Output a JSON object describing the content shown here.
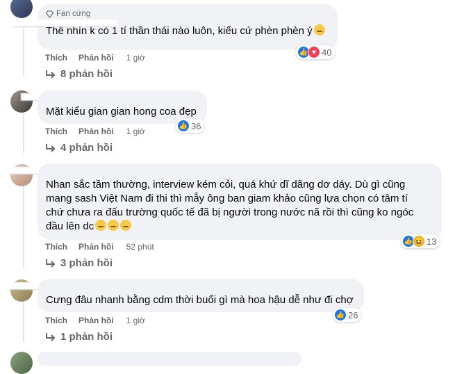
{
  "comments": [
    {
      "badge": "Fan cứng",
      "text": "Thề nhìn k có 1 tí thần thái nào luôn, kiểu cứ phèn phèn ý",
      "like": "Thích",
      "reply": "Phản hồi",
      "time": "1 giờ",
      "reaction_count": "40",
      "replies": "8 phản hồi"
    },
    {
      "text": "Mặt kiểu gian gian hong coa đẹp",
      "like": "Thích",
      "reply": "Phản hồi",
      "time": "1 giờ",
      "reaction_count": "36",
      "replies": "4 phản hồi"
    },
    {
      "text_lines": [
        "Nhan sắc tầm thường, interview kém cỏi, quá khứ dĩ dãng dơ dáy. Dù gì cũng",
        "mang sash Việt Nam đi thi thì mẫy ông ban giam khảo cũng lựa chọn có tâm tí",
        "chứ chưa ra đấu trường quốc tế đã bị người trong nước nã rồi thì cũng ko ngóc",
        "đầu lên dc"
      ],
      "like": "Thích",
      "reply": "Phản hồi",
      "time": "52 phút",
      "reaction_count": "13",
      "replies": "3 phản hồi"
    },
    {
      "text": "Cưng đâu nhanh bằng cdm thời buổi gì mà hoa hậu dễ như đi chợ",
      "like": "Thích",
      "reply": "Phản hồi",
      "time": "1 giờ",
      "reaction_count": "26",
      "replies": "1 phản hồi"
    }
  ],
  "icons": {
    "reply_arrow": "reply-arrow-icon",
    "badge": "diamond-badge-icon",
    "like": "like-reaction-icon",
    "love": "love-reaction-icon",
    "haha": "haha-reaction-icon",
    "emoji": "pleading-face-icon"
  },
  "colors": {
    "like": "#1877f2",
    "love": "#f33e58",
    "haha": "#f7b125",
    "bubble": "#f0f2f5"
  }
}
